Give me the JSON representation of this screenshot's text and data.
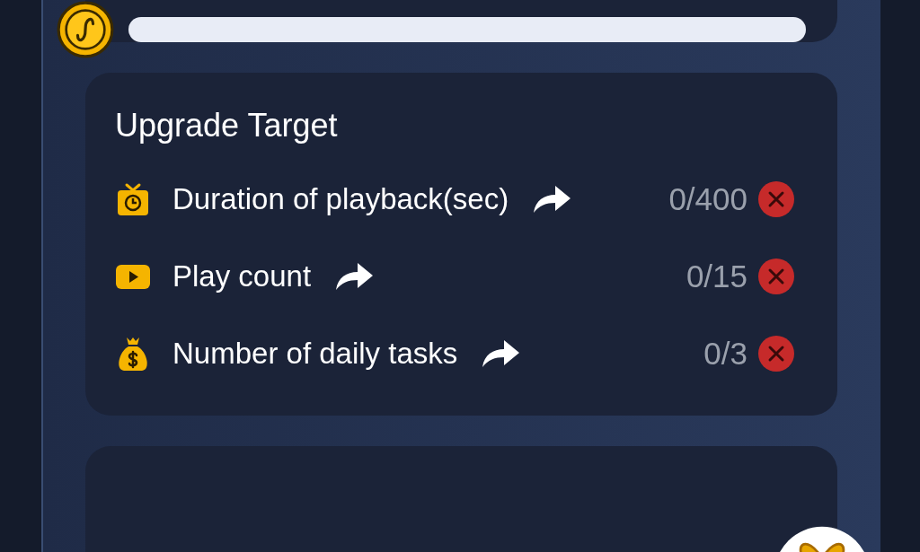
{
  "progress": {
    "level": 0
  },
  "upgrade_target": {
    "title": "Upgrade Target",
    "tasks": [
      {
        "kind": "timer",
        "label": "Duration of playback(sec)",
        "value": "0/400",
        "done": false
      },
      {
        "kind": "video",
        "label": "Play count",
        "value": "0/15",
        "done": false
      },
      {
        "kind": "money",
        "label": "Number of daily tasks",
        "value": "0/3",
        "done": false
      }
    ]
  }
}
